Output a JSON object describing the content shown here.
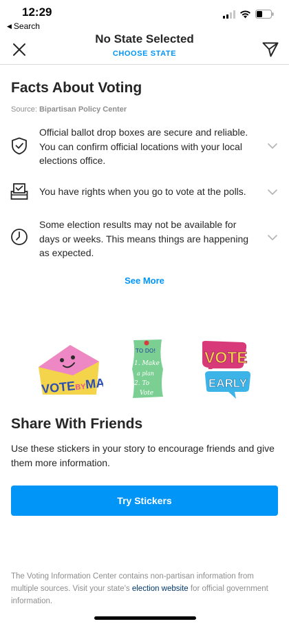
{
  "status_bar": {
    "time": "12:29",
    "back_label": "Search"
  },
  "header": {
    "title": "No State Selected",
    "subtitle": "CHOOSE STATE"
  },
  "facts": {
    "title": "Facts About Voting",
    "source_prefix": "Source: ",
    "source_name": "Bipartisan Policy Center",
    "items": [
      {
        "icon": "shield-check-icon",
        "text": "Official ballot drop boxes are secure and reliable. You can confirm official locations with your local elections office."
      },
      {
        "icon": "ballot-box-icon",
        "text": "You have rights when you go to vote at the polls."
      },
      {
        "icon": "clock-icon",
        "text": "Some election results may not be available for days or weeks. This means things are happening as expected."
      }
    ],
    "see_more": "See More"
  },
  "stickers": [
    {
      "name": "vote-by-mail-sticker",
      "text_a": "VOTE",
      "text_b": "BY",
      "text_c": "MAIL"
    },
    {
      "name": "todo-sticker",
      "line1": "TO DO!",
      "line2": "1. Make",
      "line3": "a plan",
      "line4": "2. To",
      "line5": "Vote"
    },
    {
      "name": "vote-early-sticker",
      "text_a": "VOTE",
      "text_b": "EARLY"
    }
  ],
  "share": {
    "title": "Share With Friends",
    "description": "Use these stickers in your story to encourage friends and give them more information.",
    "button_label": "Try Stickers"
  },
  "footer": {
    "text_before": "The Voting Information Center contains non-partisan information from multiple sources. Visit your state's ",
    "link": "election website",
    "text_after": " for official government information."
  },
  "colors": {
    "accent": "#0095f6",
    "link_dark": "#00376b",
    "text": "#262626",
    "secondary": "#8e8e8e"
  }
}
